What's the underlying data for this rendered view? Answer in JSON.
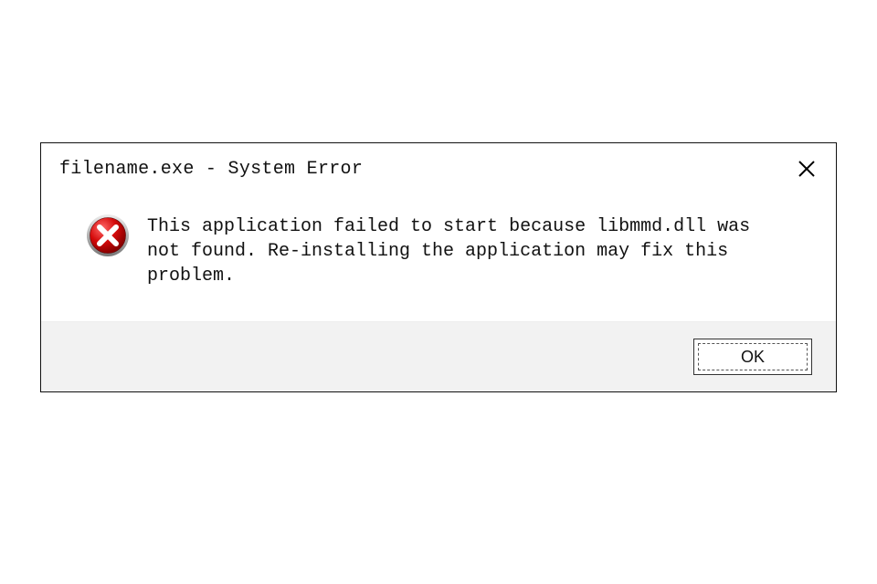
{
  "dialog": {
    "title": "filename.exe - System Error",
    "message": "This application failed to start because libmmd.dll was not found. Re-installing the application may fix this problem.",
    "buttons": {
      "ok_label": "OK"
    },
    "icons": {
      "close": "close-icon",
      "error": "error-x-icon"
    }
  }
}
